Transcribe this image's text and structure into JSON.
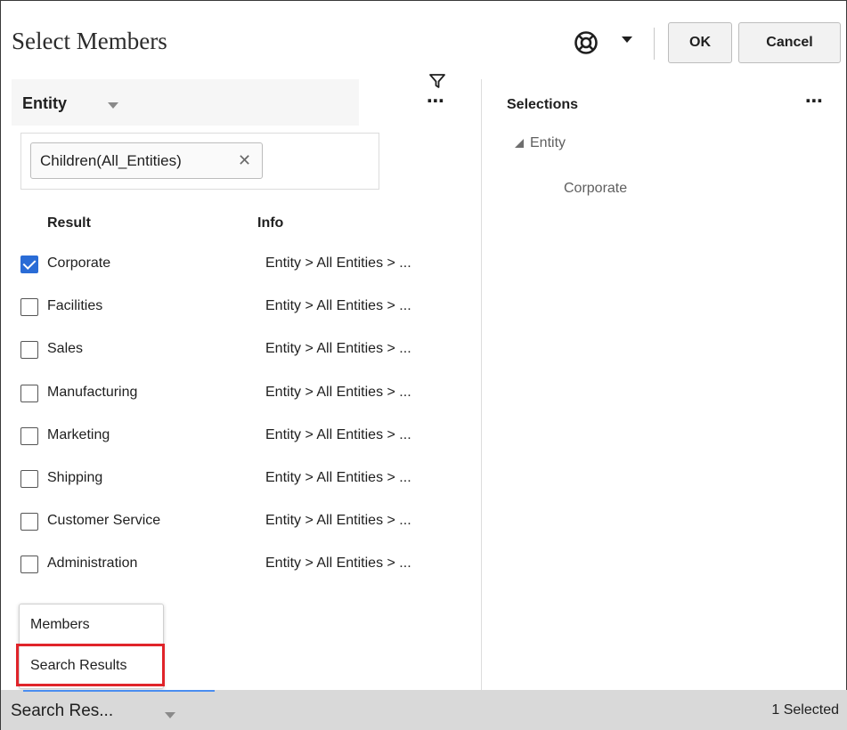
{
  "dialog": {
    "title": "Select Members",
    "ok_label": "OK",
    "cancel_label": "Cancel"
  },
  "left_panel": {
    "dimension_label": "Entity",
    "search_chip": "Children(All_Entities)",
    "columns": {
      "result": "Result",
      "info": "Info"
    },
    "rows": [
      {
        "name": "Corporate",
        "info": "Entity > All Entities > ...",
        "checked": true
      },
      {
        "name": "Facilities",
        "info": "Entity > All Entities > ...",
        "checked": false
      },
      {
        "name": "Sales",
        "info": "Entity > All Entities > ...",
        "checked": false
      },
      {
        "name": "Manufacturing",
        "info": "Entity > All Entities > ...",
        "checked": false
      },
      {
        "name": "Marketing",
        "info": "Entity > All Entities > ...",
        "checked": false
      },
      {
        "name": "Shipping",
        "info": "Entity > All Entities > ...",
        "checked": false
      },
      {
        "name": "Customer Service",
        "info": "Entity > All Entities > ...",
        "checked": false
      },
      {
        "name": "Administration",
        "info": "Entity > All Entities > ...",
        "checked": false
      }
    ]
  },
  "view_menu": {
    "items": [
      "Members",
      "Search Results"
    ]
  },
  "right_panel": {
    "title": "Selections",
    "tree_root": "Entity",
    "tree_child": "Corporate"
  },
  "status_bar": {
    "view_select": "Search Res...",
    "selected_count": "1 Selected"
  },
  "icons": {
    "help": "help-lifebuoy-icon",
    "more": "more-icon",
    "filter": "filter-icon",
    "remove": "close-icon"
  },
  "colors": {
    "checkbox_checked": "#2a6cd6",
    "highlight": "#e0242a",
    "status_bar": "#d9d9d9",
    "focus_underline": "#4a8df0"
  }
}
